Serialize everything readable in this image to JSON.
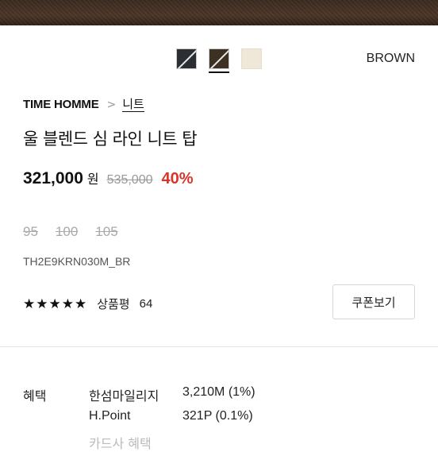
{
  "color_options": {
    "items": [
      {
        "name": "charcoal",
        "color": "#2b2e33"
      },
      {
        "name": "brown",
        "color": "#3d3124"
      },
      {
        "name": "cream",
        "color": "#efe7d8"
      }
    ],
    "selected_label": "BROWN"
  },
  "breadcrumb": {
    "brand": "TIME HOMME",
    "category": "니트"
  },
  "product": {
    "title": "울 블렌드 심 라인 니트 탑",
    "price": "321,000",
    "currency": "원",
    "original_price": "535,000",
    "discount": "40%",
    "sizes": [
      "95",
      "100",
      "105"
    ],
    "code": "TH2E9KRN030M_BR"
  },
  "reviews": {
    "stars": "★★★★★",
    "label": "상품평",
    "count": "64"
  },
  "coupon_button_label": "쿠폰보기",
  "benefits": {
    "heading": "혜택",
    "rows": [
      {
        "name": "한섬마일리지",
        "value": "3,210M (1%)"
      },
      {
        "name": "H.Point",
        "value": "321P (0.1%)"
      },
      {
        "name": "카드사 혜택",
        "value": ""
      }
    ]
  },
  "colors": {
    "discount": "#d9342b",
    "muted": "#999999"
  }
}
